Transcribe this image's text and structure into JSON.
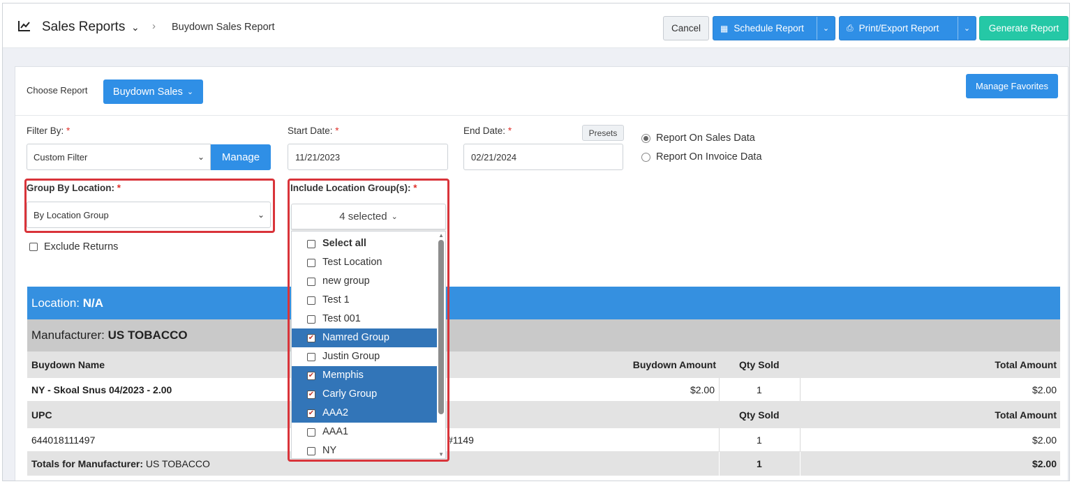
{
  "header": {
    "title": "Sales Reports",
    "breadcrumb": "Buydown Sales Report",
    "cancel": "Cancel",
    "schedule": "Schedule Report",
    "print_export": "Print/Export Report",
    "generate": "Generate Report"
  },
  "report": {
    "choose_label": "Choose Report",
    "choose_value": "Buydown Sales",
    "manage_favorites": "Manage Favorites"
  },
  "filters": {
    "filter_by_label": "Filter By:",
    "filter_by_value": "Custom Filter",
    "manage": "Manage",
    "start_label": "Start Date:",
    "start_value": "11/21/2023",
    "end_label": "End Date:",
    "end_value": "02/21/2024",
    "presets": "Presets",
    "radio_sales": "Report On Sales Data",
    "radio_invoice": "Report On Invoice Data",
    "group_by_label": "Group By Location:",
    "group_by_value": "By Location Group",
    "include_label": "Include Location Group(s):",
    "required_mark": "*",
    "exclude_returns": "Exclude Returns"
  },
  "dropdown": {
    "button": "4 selected",
    "items": [
      {
        "label": "Select all",
        "checked": false
      },
      {
        "label": "Test Location",
        "checked": false
      },
      {
        "label": "new group",
        "checked": false
      },
      {
        "label": "Test 1",
        "checked": false
      },
      {
        "label": "Test 001",
        "checked": false
      },
      {
        "label": "Namred Group",
        "checked": true
      },
      {
        "label": "Justin Group",
        "checked": false
      },
      {
        "label": "Memphis",
        "checked": true
      },
      {
        "label": "Carly Group",
        "checked": true
      },
      {
        "label": "AAA2",
        "checked": true
      },
      {
        "label": "AAA1",
        "checked": false
      },
      {
        "label": "NY",
        "checked": false
      }
    ]
  },
  "table": {
    "location_label": "Location:",
    "location_value": "N/A",
    "manufacturer_label": "Manufacturer:",
    "manufacturer_value": "US TOBACCO",
    "headers": {
      "buydown_name": "Buydown Name",
      "buydown_amount": "Buydown Amount",
      "qty_sold": "Qty Sold",
      "total_amount": "Total Amount"
    },
    "buydown_row": {
      "name": "NY - Skoal Snus 04/2023 - 2.00",
      "amount": "$2.00",
      "qty": "1",
      "total": "$2.00"
    },
    "upc_headers": {
      "upc": "UPC",
      "qty_sold": "Qty Sold",
      "total_amount": "Total Amount"
    },
    "upc_row": {
      "upc": "644018111497",
      "desc_fragment": "#1149",
      "qty": "1",
      "total": "$2.00"
    },
    "totals_row": {
      "label": "Totals for Manufacturer:",
      "value": "US TOBACCO",
      "qty": "1",
      "total": "$2.00"
    }
  }
}
